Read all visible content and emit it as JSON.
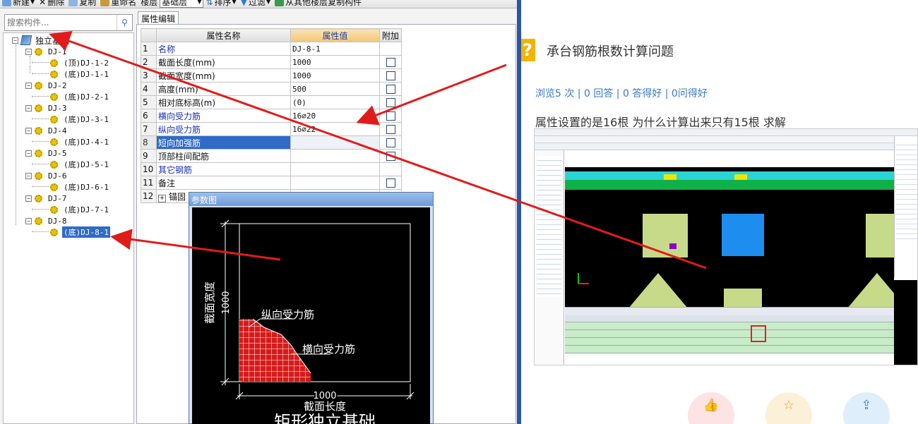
{
  "toolbar": {
    "items": [
      "新建",
      "删除",
      "复制",
      "重命名",
      "楼层",
      "基础层",
      "排序",
      "过滤",
      "从其他楼层复制构件"
    ]
  },
  "search": {
    "placeholder": "搜索构件..."
  },
  "tree": {
    "root": "独立基础",
    "groups": [
      {
        "name": "DJ-1",
        "children": [
          "(顶)DJ-1-2",
          "(底)DJ-1-1"
        ]
      },
      {
        "name": "DJ-2",
        "children": [
          "(底)DJ-2-1"
        ]
      },
      {
        "name": "DJ-3",
        "children": [
          "(底)DJ-3-1"
        ]
      },
      {
        "name": "DJ-4",
        "children": [
          "(底)DJ-4-1"
        ]
      },
      {
        "name": "DJ-5",
        "children": [
          "(底)DJ-5-1"
        ]
      },
      {
        "name": "DJ-6",
        "children": [
          "(底)DJ-6-1"
        ]
      },
      {
        "name": "DJ-7",
        "children": [
          "(底)DJ-7-1"
        ]
      },
      {
        "name": "DJ-8",
        "children": [
          "(底)DJ-8-1"
        ]
      }
    ]
  },
  "props": {
    "tab": "属性编辑",
    "headers": {
      "name": "属性名称",
      "value": "属性值",
      "extra": "附加"
    },
    "rows": [
      {
        "n": "1",
        "name": "名称",
        "value": "DJ-8-1"
      },
      {
        "n": "2",
        "name": "截面长度(mm)",
        "value": "1000"
      },
      {
        "n": "3",
        "name": "截面宽度(mm)",
        "value": "1000"
      },
      {
        "n": "4",
        "name": "高度(mm)",
        "value": "500"
      },
      {
        "n": "5",
        "name": "相对底标高(m)",
        "value": "(0)"
      },
      {
        "n": "6",
        "name": "横向受力筋",
        "value": "16⌀20"
      },
      {
        "n": "7",
        "name": "纵向受力筋",
        "value": "16⌀22"
      },
      {
        "n": "8",
        "name": "短向加强筋",
        "value": ""
      },
      {
        "n": "9",
        "name": "顶部柱间配筋",
        "value": ""
      },
      {
        "n": "10",
        "name": "其它钢筋",
        "value": ""
      },
      {
        "n": "11",
        "name": "备注",
        "value": ""
      },
      {
        "n": "12",
        "name": "锚固",
        "value": ""
      }
    ]
  },
  "param_dialog": {
    "title": "参数图",
    "width_label": "截面宽度",
    "width_value": "1000",
    "length_value": "1000",
    "length_label": "截面长度",
    "long_bar_label": "纵向受力筋",
    "trans_bar_label": "横向受力筋",
    "caption": "矩形独立基础"
  },
  "question": {
    "icon": "?",
    "title": "承台钢筋根数计算问题",
    "stats": "浏览5 次 | 0 回答 | 0 答得好 | 0问得好",
    "body": "属性设置的是16根  为什么计算出来只有15根 求解"
  },
  "colors": {
    "selection": "#2f6bc7",
    "arrow": "#e11b1b",
    "link": "#3a78c8"
  }
}
